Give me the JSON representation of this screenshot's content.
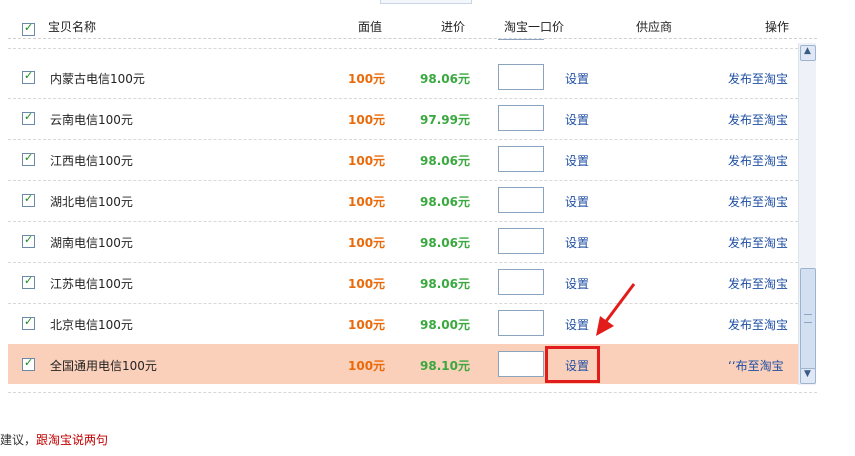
{
  "header": {
    "columns": {
      "name": "宝贝名称",
      "face": "面值",
      "cost": "进价",
      "price": "淘宝一口价",
      "supplier": "供应商",
      "action": "操作"
    }
  },
  "rows": [
    {
      "name": "内蒙古电信100元",
      "face": "100元",
      "cost": "98.06元",
      "set": "设置",
      "publish": "发布至淘宝"
    },
    {
      "name": "云南电信100元",
      "face": "100元",
      "cost": "97.99元",
      "set": "设置",
      "publish": "发布至淘宝"
    },
    {
      "name": "江西电信100元",
      "face": "100元",
      "cost": "98.06元",
      "set": "设置",
      "publish": "发布至淘宝"
    },
    {
      "name": "湖北电信100元",
      "face": "100元",
      "cost": "98.06元",
      "set": "设置",
      "publish": "发布至淘宝"
    },
    {
      "name": "湖南电信100元",
      "face": "100元",
      "cost": "98.06元",
      "set": "设置",
      "publish": "发布至淘宝"
    },
    {
      "name": "江苏电信100元",
      "face": "100元",
      "cost": "98.06元",
      "set": "设置",
      "publish": "发布至淘宝"
    },
    {
      "name": "北京电信100元",
      "face": "100元",
      "cost": "98.00元",
      "set": "设置",
      "publish": "发布至淘宝"
    },
    {
      "name": "全国通用电信100元",
      "face": "100元",
      "cost": "98.10元",
      "set": "设置",
      "publish": "‘‘布至淘宝"
    }
  ],
  "footer": {
    "prefix": "建议，",
    "link": "跟淘宝说两句"
  },
  "colors": {
    "face": "#ea6a0a",
    "cost": "#39a83e",
    "link": "#1f4fa3",
    "highlight_row": "#fbd0bb",
    "annotation": "#e21b1b"
  }
}
